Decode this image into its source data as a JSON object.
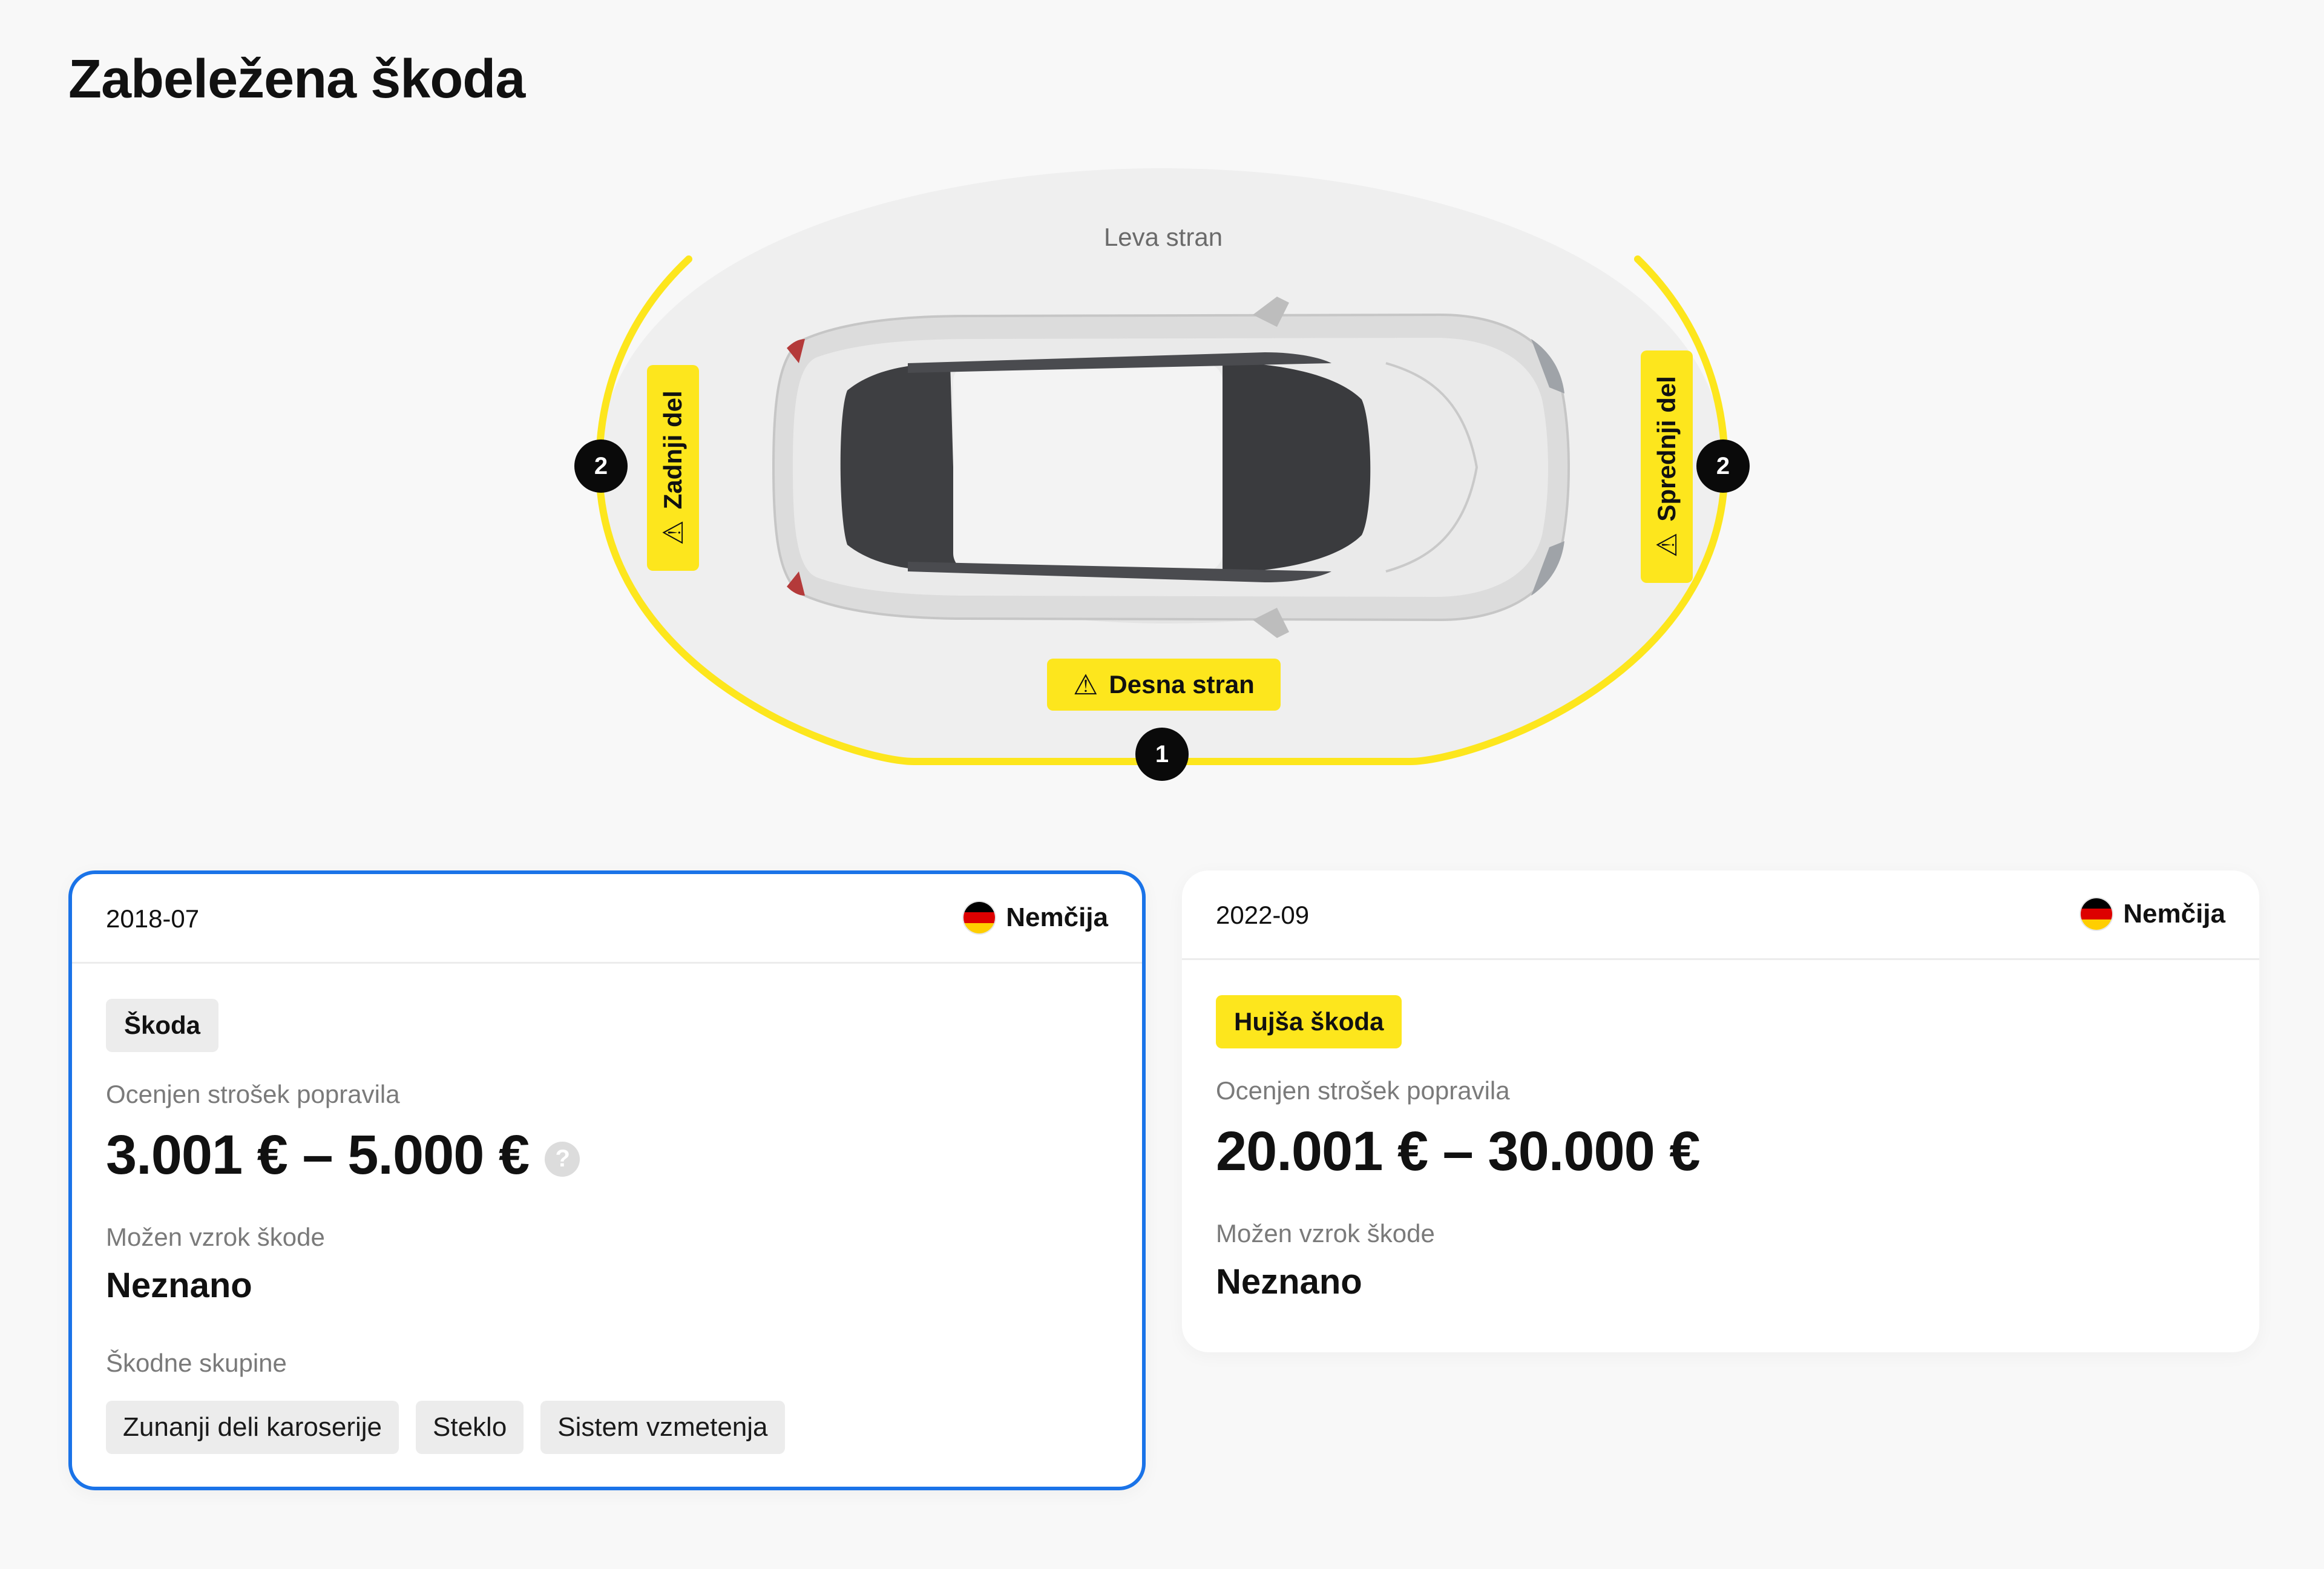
{
  "page": {
    "title": "Zabeležena škoda"
  },
  "diagram": {
    "top_label": "Leva stran",
    "bottom_tag": "Desna stran",
    "left_tag": "Zadnji del",
    "right_tag": "Sprednji del",
    "bottom_count": "1",
    "left_count": "2",
    "right_count": "2",
    "warning_icon": "warning-triangle-icon",
    "highlight_color": "#fde61d"
  },
  "records": [
    {
      "date": "2018-07",
      "country": "Nemčija",
      "flag_icon": "germany-flag-icon",
      "severity": "Škoda",
      "cost_label": "Ocenjen strošek popravila",
      "cost": "3.001 € – 5.000 €",
      "help_icon": "?",
      "cause_label": "Možen vzrok škode",
      "cause": "Neznano",
      "groups_label": "Škodne skupine",
      "groups": [
        "Zunanji deli karoserije",
        "Steklo",
        "Sistem vzmetenja"
      ],
      "selected": true
    },
    {
      "date": "2022-09",
      "country": "Nemčija",
      "flag_icon": "germany-flag-icon",
      "severity": "Hujša škoda",
      "cost_label": "Ocenjen strošek popravila",
      "cost": "20.001 € – 30.000 €",
      "cause_label": "Možen vzrok škode",
      "cause": "Neznano",
      "selected": false
    }
  ],
  "colors": {
    "selected_border": "#1a73e8",
    "severity_minor": "#ececec",
    "severity_major": "#fde61d"
  }
}
